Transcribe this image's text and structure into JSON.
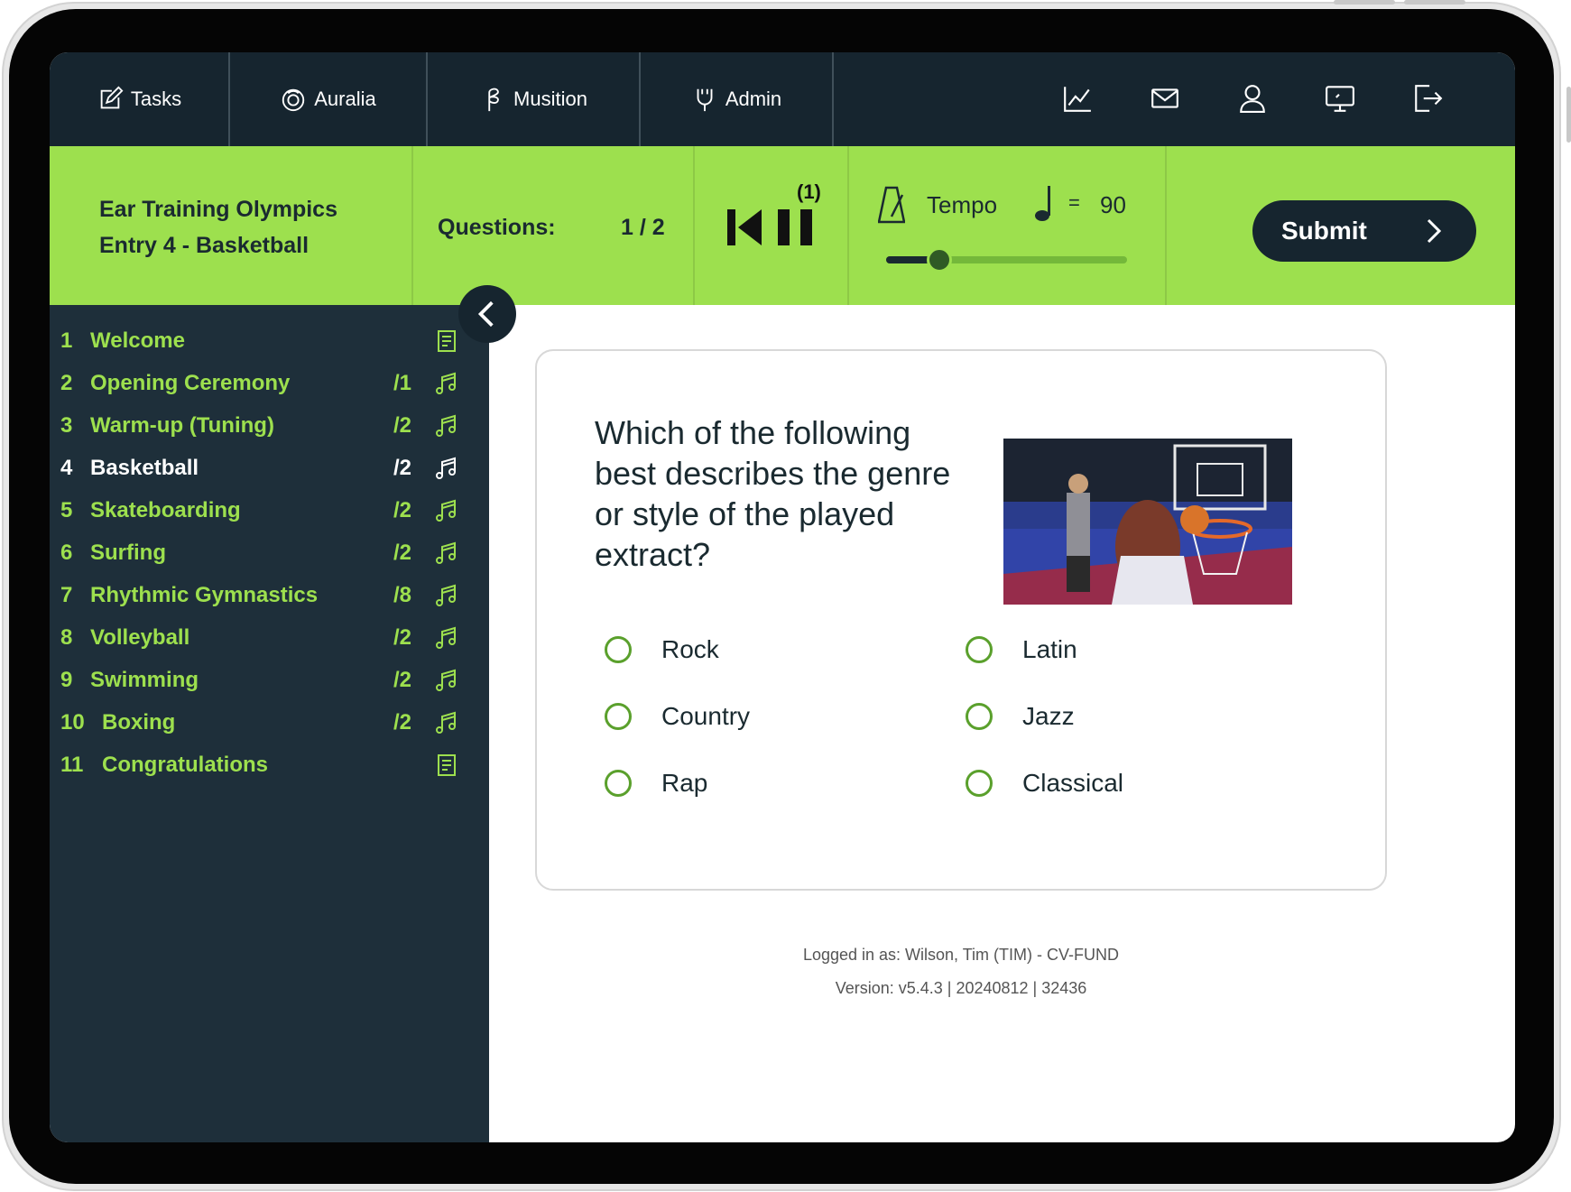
{
  "nav": {
    "items": [
      {
        "label": "Tasks",
        "icon": "edit-icon"
      },
      {
        "label": "Auralia",
        "icon": "auralia-icon"
      },
      {
        "label": "Musition",
        "icon": "musition-icon"
      },
      {
        "label": "Admin",
        "icon": "admin-icon"
      }
    ],
    "icons": [
      "chart-icon",
      "mail-icon",
      "user-icon",
      "monitor-icon",
      "logout-icon"
    ]
  },
  "header": {
    "title_line1": "Ear Training Olympics",
    "title_line2": "Entry 4 - Basketball",
    "questions_label": "Questions:",
    "questions_value": "1 / 2",
    "replay_count": "(1)",
    "tempo_label": "Tempo",
    "tempo_equals": "=",
    "tempo_value": "90",
    "tempo_slider_fraction": 0.22,
    "submit_label": "Submit"
  },
  "sidebar": {
    "items": [
      {
        "num": "1",
        "label": "Welcome",
        "count": "",
        "icon": "document-icon"
      },
      {
        "num": "2",
        "label": "Opening Ceremony",
        "count": "/1",
        "icon": "music-note-icon"
      },
      {
        "num": "3",
        "label": "Warm-up (Tuning)",
        "count": "/2",
        "icon": "music-note-icon"
      },
      {
        "num": "4",
        "label": "Basketball",
        "count": "/2",
        "icon": "music-note-icon",
        "active": true
      },
      {
        "num": "5",
        "label": "Skateboarding",
        "count": "/2",
        "icon": "music-note-icon"
      },
      {
        "num": "6",
        "label": "Surfing",
        "count": "/2",
        "icon": "music-note-icon"
      },
      {
        "num": "7",
        "label": "Rhythmic Gymnastics",
        "count": "/8",
        "icon": "music-note-icon"
      },
      {
        "num": "8",
        "label": "Volleyball",
        "count": "/2",
        "icon": "music-note-icon"
      },
      {
        "num": "9",
        "label": "Swimming",
        "count": "/2",
        "icon": "music-note-icon"
      },
      {
        "num": "10",
        "label": "Boxing",
        "count": "/2",
        "icon": "music-note-icon"
      },
      {
        "num": "11",
        "label": "Congratulations",
        "count": "",
        "icon": "document-icon"
      }
    ]
  },
  "question": {
    "text": "Which of the following best describes the genre or style of the played extract?",
    "options": [
      "Rock",
      "Latin",
      "Country",
      "Jazz",
      "Rap",
      "Classical"
    ]
  },
  "footer": {
    "logged_in": "Logged in as: Wilson, Tim (TIM) - CV-FUND",
    "version": "Version: v5.4.3 | 20240812 | 32436"
  },
  "colors": {
    "nav_bg": "#16252f",
    "accent_green": "#9de04e",
    "sidebar_bg": "#1e2f3a",
    "radio_green": "#5aa02c"
  }
}
